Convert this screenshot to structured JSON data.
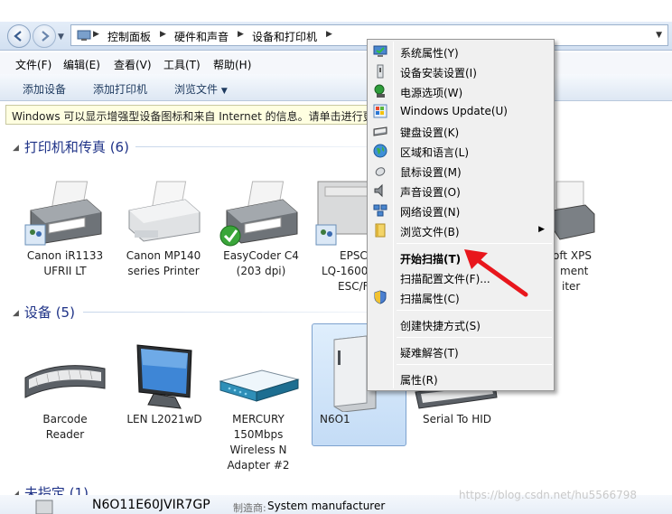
{
  "address": {
    "crumbs": [
      "控制面板",
      "硬件和声音",
      "设备和打印机"
    ]
  },
  "menubar": {
    "items": [
      "文件(F)",
      "编辑(E)",
      "查看(V)",
      "工具(T)",
      "帮助(H)"
    ]
  },
  "toolbar": {
    "items": [
      "添加设备",
      "添加打印机",
      "浏览文件"
    ]
  },
  "infobar": {
    "text": "Windows 可以显示增强型设备图标和来自 Internet 的信息。请单击进行更"
  },
  "groups": {
    "printers": {
      "title": "打印机和传真 (6)"
    },
    "devices": {
      "title": "设备 (5)"
    },
    "unspecified": {
      "title": "未指定 (1)"
    }
  },
  "printers": [
    {
      "line1": "Canon iR1133",
      "line2": "UFRII LT"
    },
    {
      "line1": "Canon MP140",
      "line2": "series Printer"
    },
    {
      "line1": "EasyCoder C4",
      "line2": "(203 dpi)"
    },
    {
      "line1": "EPSC",
      "line2": "LQ-1600",
      "line3": "ESC/F"
    },
    {
      "line1": "oft XPS",
      "line2": "ment",
      "line3": "iter"
    }
  ],
  "devices": [
    {
      "line1": "Barcode",
      "line2": "Reader"
    },
    {
      "line1": "LEN L2021wD"
    },
    {
      "line1": "MERCURY",
      "line2": "150Mbps",
      "line3": "Wireless N",
      "line4": "Adapter #2"
    },
    {
      "line1": "N6O1"
    },
    {
      "line1": "Serial To HID"
    }
  ],
  "context_menu": {
    "items": [
      {
        "label": "系统属性(Y)",
        "icon": "system-properties-icon"
      },
      {
        "label": "设备安装设置(I)",
        "icon": "device-install-icon"
      },
      {
        "label": "电源选项(W)",
        "icon": "power-options-icon"
      },
      {
        "label": "Windows Update(U)",
        "icon": "windows-update-icon"
      },
      {
        "label": "键盘设置(K)",
        "icon": "keyboard-icon"
      },
      {
        "label": "区域和语言(L)",
        "icon": "region-language-icon"
      },
      {
        "label": "鼠标设置(M)",
        "icon": "mouse-icon"
      },
      {
        "label": "声音设置(O)",
        "icon": "sound-icon"
      },
      {
        "label": "网络设置(N)",
        "icon": "network-icon"
      },
      {
        "label": "浏览文件(B)",
        "icon": "folder-icon"
      },
      {
        "label": "开始扫描(T)",
        "icon": "",
        "bold": true
      },
      {
        "label": "扫描配置文件(F)...",
        "icon": ""
      },
      {
        "label": "扫描属性(C)",
        "icon": "shield-icon"
      },
      {
        "label": "创建快捷方式(S)",
        "icon": ""
      },
      {
        "label": "疑难解答(T)",
        "icon": ""
      },
      {
        "label": "属性(R)",
        "icon": ""
      }
    ]
  },
  "status": {
    "name": "N6O11E60JVIR7GP",
    "manufacturer_label": "制造商:",
    "manufacturer_value": "System manufacturer"
  },
  "watermark": "https://blog.csdn.net/hu5566798"
}
